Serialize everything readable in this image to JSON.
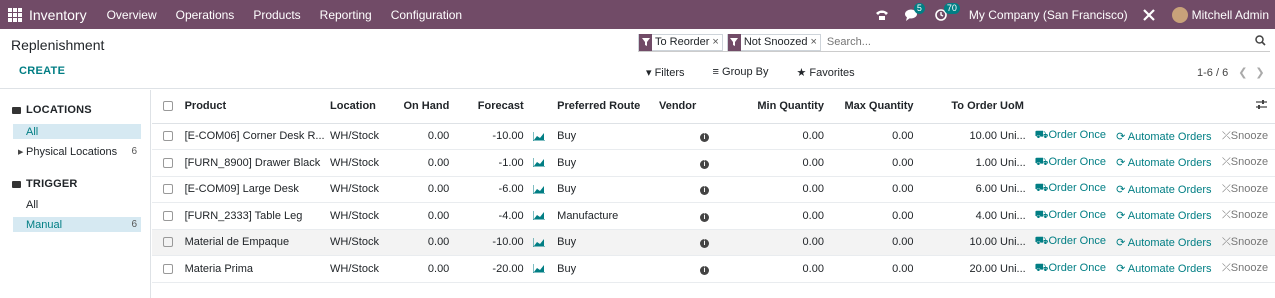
{
  "navbar": {
    "app_name": "Inventory",
    "menus": [
      "Overview",
      "Operations",
      "Products",
      "Reporting",
      "Configuration"
    ],
    "messages_count": "5",
    "activities_count": "70",
    "company": "My Company (San Francisco)",
    "user": "Mitchell Admin"
  },
  "control_panel": {
    "title": "Replenishment",
    "create_label": "CREATE",
    "facets": [
      "To Reorder",
      "Not Snoozed"
    ],
    "search_placeholder": "Search...",
    "filters_label": "Filters",
    "groupby_label": "Group By",
    "favorites_label": "Favorites",
    "pager": "1-6 / 6"
  },
  "sidebar": {
    "locations_title": "LOCATIONS",
    "locations": [
      {
        "label": "All",
        "count": ""
      },
      {
        "label": "Physical Locations",
        "count": "6"
      }
    ],
    "trigger_title": "TRIGGER",
    "triggers": [
      {
        "label": "All",
        "count": ""
      },
      {
        "label": "Manual",
        "count": "6"
      }
    ]
  },
  "table": {
    "headers": {
      "product": "Product",
      "location": "Location",
      "on_hand": "On Hand",
      "forecast": "Forecast",
      "route": "Preferred Route",
      "vendor": "Vendor",
      "min_qty": "Min Quantity",
      "max_qty": "Max Quantity",
      "to_order": "To Order",
      "uom": "UoM"
    },
    "rows": [
      {
        "product": "[E-COM06] Corner Desk R...",
        "location": "WH/Stock",
        "on_hand": "0.00",
        "forecast": "-10.00",
        "route": "Buy",
        "min_qty": "0.00",
        "max_qty": "0.00",
        "to_order": "10.00",
        "uom": "Uni..."
      },
      {
        "product": "[FURN_8900] Drawer Black",
        "location": "WH/Stock",
        "on_hand": "0.00",
        "forecast": "-1.00",
        "route": "Buy",
        "min_qty": "0.00",
        "max_qty": "0.00",
        "to_order": "1.00",
        "uom": "Uni..."
      },
      {
        "product": "[E-COM09] Large Desk",
        "location": "WH/Stock",
        "on_hand": "0.00",
        "forecast": "-6.00",
        "route": "Buy",
        "min_qty": "0.00",
        "max_qty": "0.00",
        "to_order": "6.00",
        "uom": "Uni..."
      },
      {
        "product": "[FURN_2333] Table Leg",
        "location": "WH/Stock",
        "on_hand": "0.00",
        "forecast": "-4.00",
        "route": "Manufacture",
        "min_qty": "0.00",
        "max_qty": "0.00",
        "to_order": "4.00",
        "uom": "Uni..."
      },
      {
        "product": "Material de Empaque",
        "location": "WH/Stock",
        "on_hand": "0.00",
        "forecast": "-10.00",
        "route": "Buy",
        "min_qty": "0.00",
        "max_qty": "0.00",
        "to_order": "10.00",
        "uom": "Uni..."
      },
      {
        "product": "Materia Prima",
        "location": "WH/Stock",
        "on_hand": "0.00",
        "forecast": "-20.00",
        "route": "Buy",
        "min_qty": "0.00",
        "max_qty": "0.00",
        "to_order": "20.00",
        "uom": "Uni..."
      }
    ],
    "actions": {
      "order_once": "Order Once",
      "automate": "Automate Orders",
      "snooze": "Snooze"
    }
  },
  "colors": {
    "navbar": "#714b67",
    "accent": "#017e84",
    "selected": "#d6e9f2"
  }
}
